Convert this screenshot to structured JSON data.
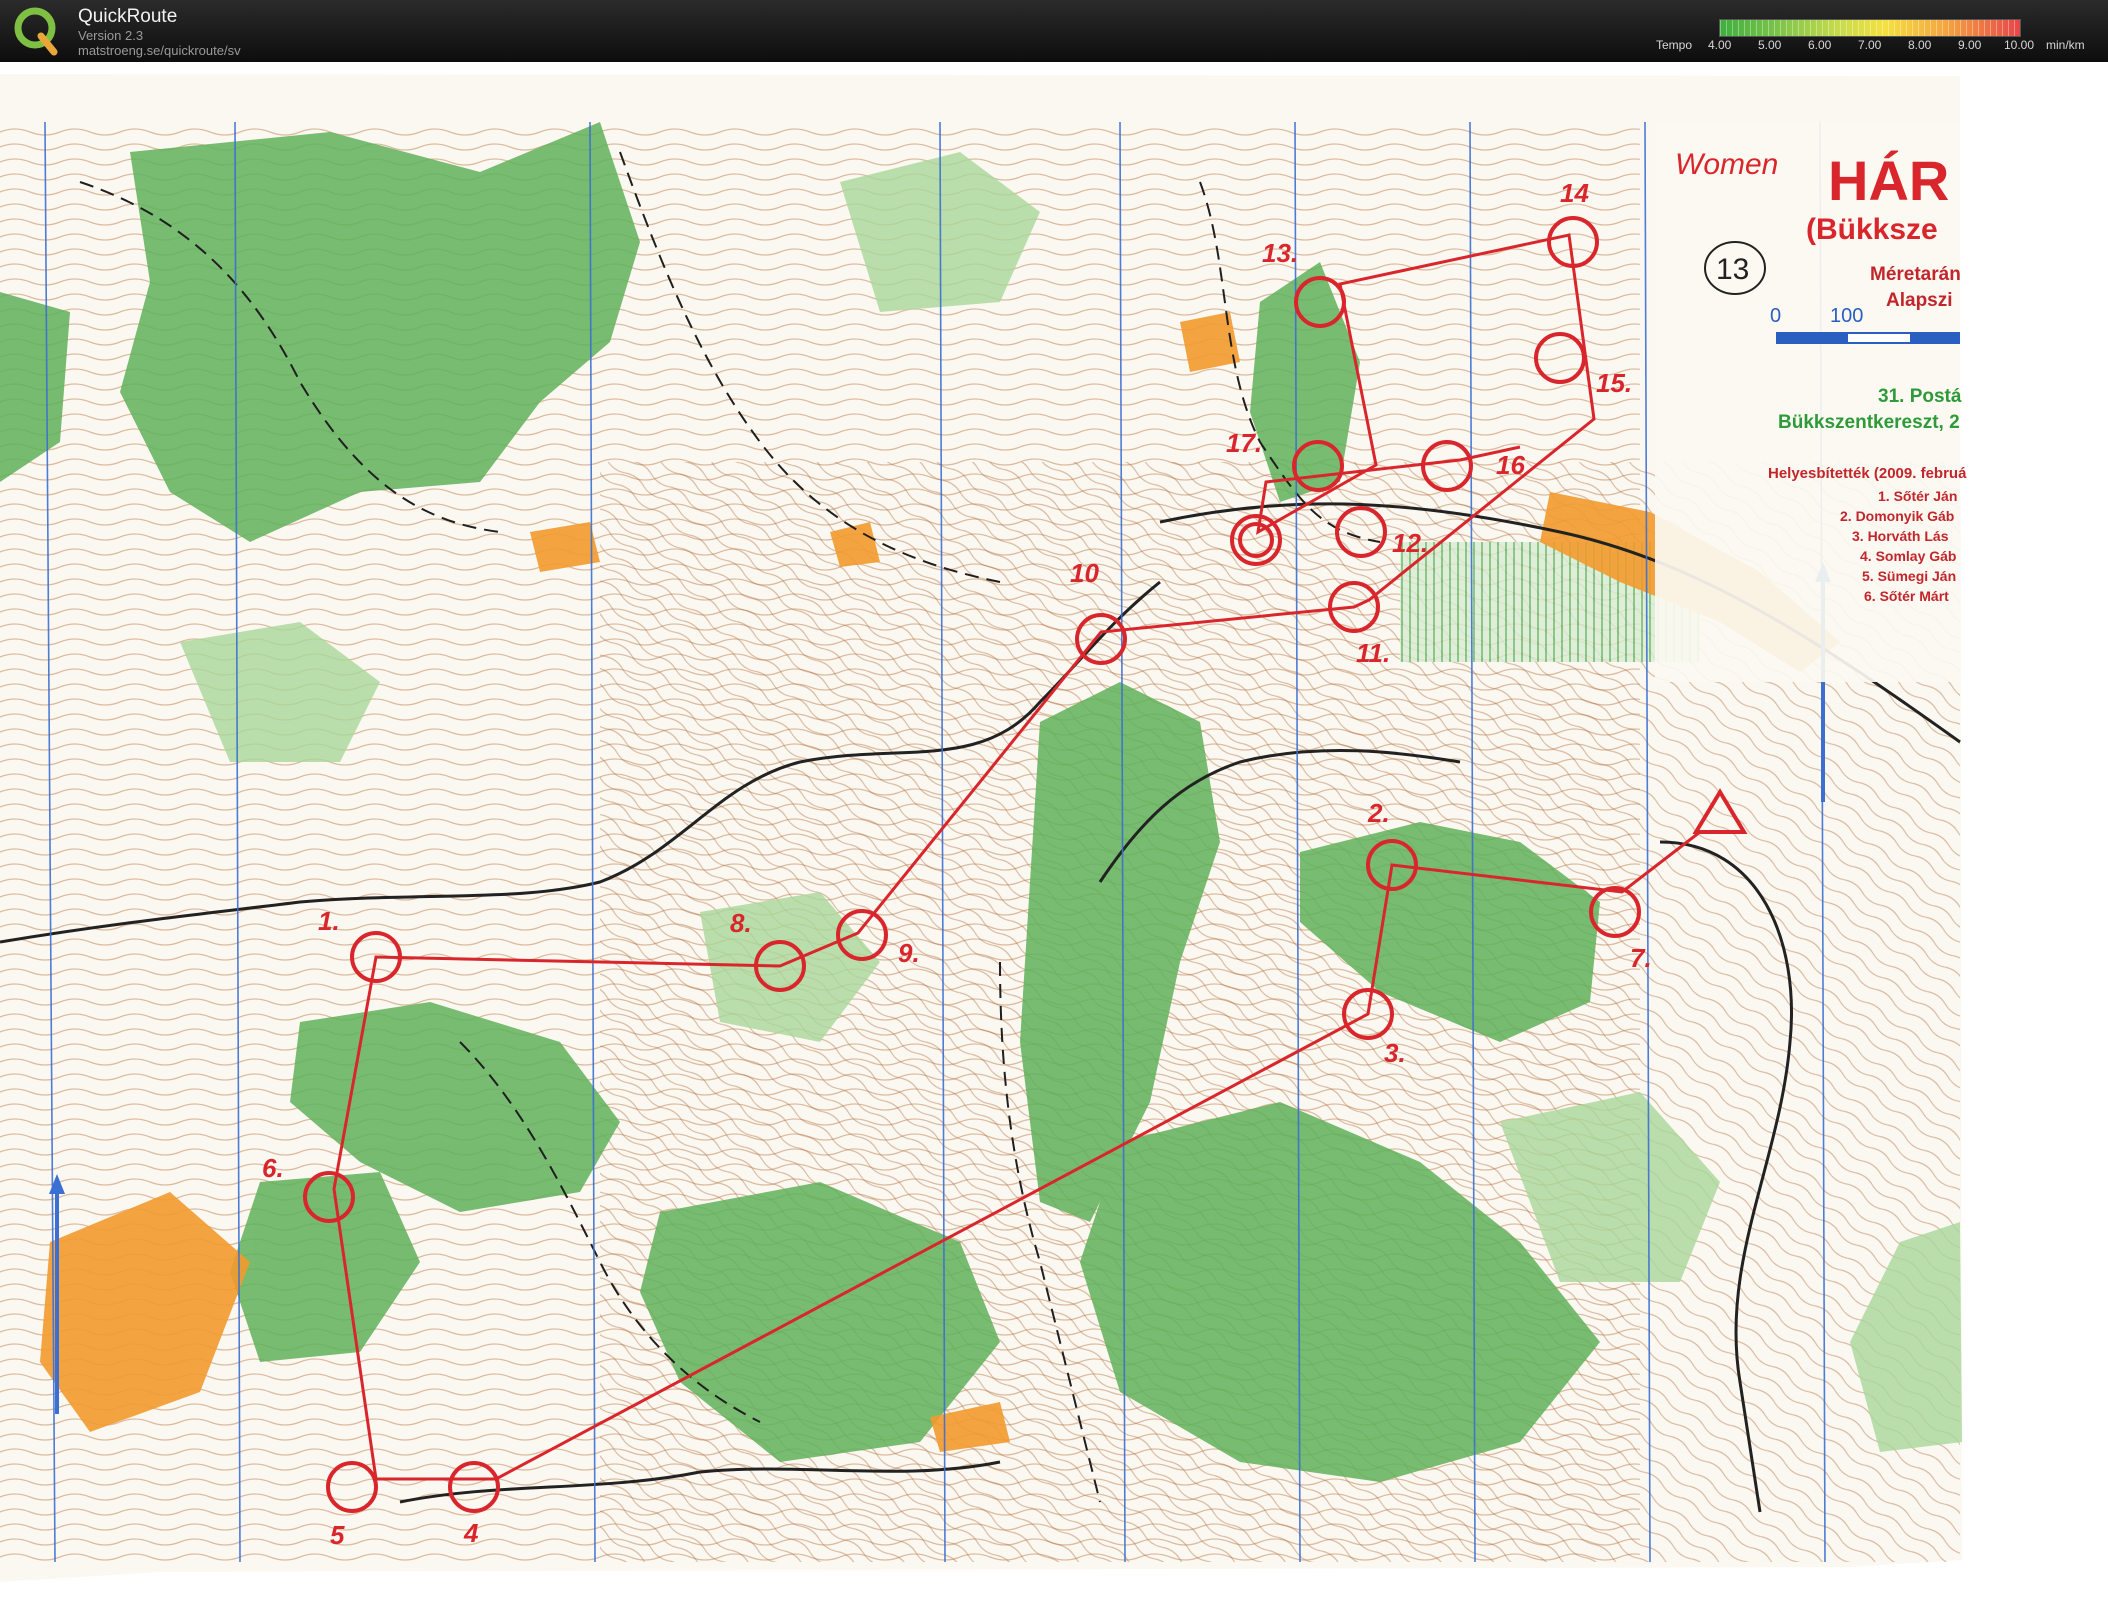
{
  "app": {
    "title": "QuickRoute",
    "version": "Version 2.3",
    "url": "matstroeng.se/quickroute/sv"
  },
  "legend": {
    "label": "Tempo",
    "ticks": [
      "4.00",
      "5.00",
      "6.00",
      "7.00",
      "8.00",
      "9.00",
      "10.00"
    ],
    "unit": "min/km"
  },
  "map": {
    "header_note": "Women",
    "title_fragment": "HÁR",
    "subtitle_fragment": "(Bükksze",
    "circled_number": "13",
    "scale_line1": "Méretarán",
    "scale_line2": "Alapszi",
    "scale_ticks": [
      "0",
      "100"
    ],
    "event_line1": "31. Postá",
    "event_line2": "Bükkszentkereszt, 2",
    "results_heading": "Helyesbítették (2009. februá",
    "results": [
      "1. Sőtér Ján",
      "2. Domonyik Gáb",
      "3. Horváth Lás",
      "4. Somlay Gáb",
      "5. Sümegi Ján",
      "6. Sőtér Márt"
    ],
    "controls": [
      {
        "label": "1."
      },
      {
        "label": "2."
      },
      {
        "label": "3."
      },
      {
        "label": "4"
      },
      {
        "label": "5"
      },
      {
        "label": "6."
      },
      {
        "label": "7."
      },
      {
        "label": "8."
      },
      {
        "label": "9."
      },
      {
        "label": "10"
      },
      {
        "label": "11."
      },
      {
        "label": "12."
      },
      {
        "label": "13."
      },
      {
        "label": "14"
      },
      {
        "label": "15."
      },
      {
        "label": "16"
      },
      {
        "label": "17."
      }
    ]
  },
  "colors": {
    "course": "#d9262c",
    "forest": "#5fb15a",
    "open": "#f29a2e",
    "contour": "#a9652f",
    "north_line": "#3b6fd1",
    "paper": "#fbf8f1"
  }
}
